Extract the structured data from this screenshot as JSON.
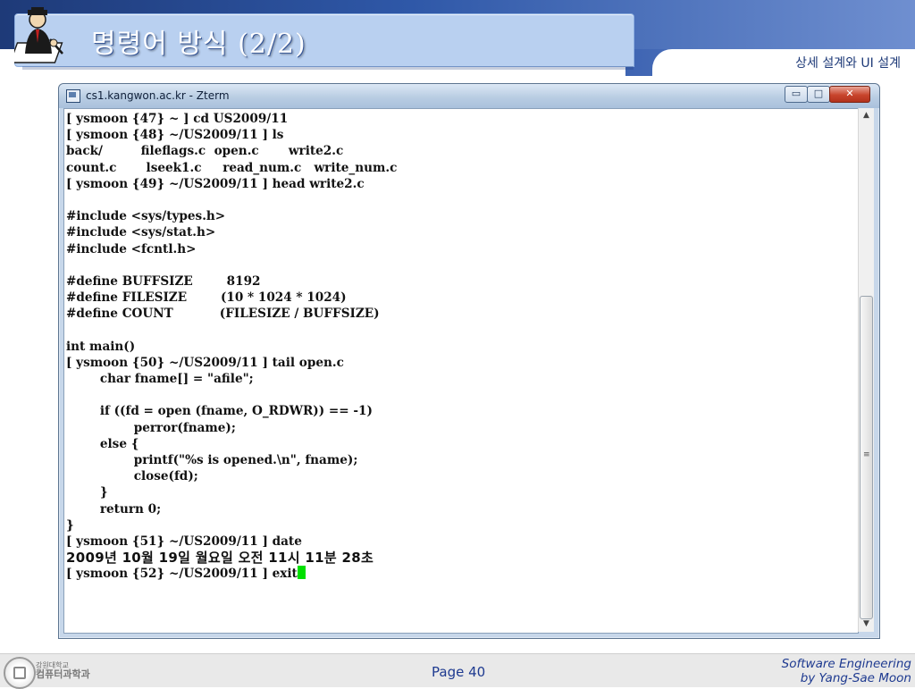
{
  "slide": {
    "title": "명령어 방식 (2/2)",
    "subtitle": "상세 설계와 UI 설계"
  },
  "window": {
    "title": "cs1.kangwon.ac.kr - Zterm",
    "buttons": {
      "minimize": "▭",
      "maximize": "□",
      "close": "✕"
    }
  },
  "terminal": {
    "lines": [
      "[ ysmoon {47} ~ ] cd US2009/11",
      "[ ysmoon {48} ~/US2009/11 ] ls",
      "back/         fileflags.c  open.c       write2.c",
      "count.c       lseek1.c     read_num.c   write_num.c",
      "[ ysmoon {49} ~/US2009/11 ] head write2.c",
      "",
      "#include <sys/types.h>",
      "#include <sys/stat.h>",
      "#include <fcntl.h>",
      "",
      "#define BUFFSIZE        8192",
      "#define FILESIZE        (10 * 1024 * 1024)",
      "#define COUNT           (FILESIZE / BUFFSIZE)",
      "",
      "int main()",
      "[ ysmoon {50} ~/US2009/11 ] tail open.c",
      "        char fname[] = \"afile\";",
      "",
      "        if ((fd = open (fname, O_RDWR)) == -1)",
      "                perror(fname);",
      "        else {",
      "                printf(\"%s is opened.\\n\", fname);",
      "                close(fd);",
      "        }",
      "        return 0;",
      "}",
      "[ ysmoon {51} ~/US2009/11 ] date"
    ],
    "date_output": "2009년 10월 19일 월요일 오전 11시 11분 28초",
    "last_prompt": "[ ysmoon {52} ~/US2009/11 ] exit",
    "cursor_color": "#00e000"
  },
  "scrollbar": {
    "up": "▲",
    "down": "▼",
    "grip": "≡"
  },
  "footer": {
    "org_line1": "강원대학교",
    "org_line2": "컴퓨터과학과",
    "page": "Page 40",
    "course_line1": "Software Engineering",
    "course_line2": "by Yang-Sae Moon"
  },
  "colors": {
    "header_band": "#2f58a8",
    "title_box": "#b9d0f0",
    "accent_text": "#1e3a90"
  }
}
